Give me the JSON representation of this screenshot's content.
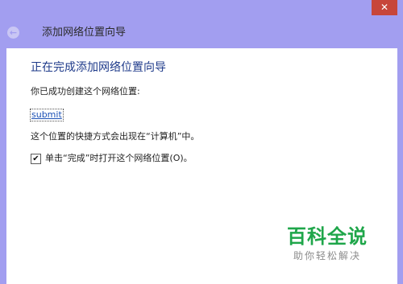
{
  "window": {
    "close_glyph": "✕",
    "back_glyph": "←",
    "title": "添加网络位置向导"
  },
  "page": {
    "heading": "正在完成添加网络位置向导",
    "created_text": "你已成功创建这个网络位置:",
    "location_name": "submit",
    "shortcut_text": "这个位置的快捷方式会出现在“计算机”中。",
    "open_checkbox": {
      "label": "单击“完成”时打开这个网络位置(O)。",
      "checked": true,
      "check_glyph": "✔"
    }
  },
  "watermark": {
    "main": "百科全说",
    "sub": "助你轻松解决"
  },
  "colors": {
    "window_bg": "#a29ef0",
    "heading": "#1e3a8a",
    "link": "#1a4fb5",
    "close_button": "#c7463a",
    "watermark_green": "#1fa64a"
  }
}
